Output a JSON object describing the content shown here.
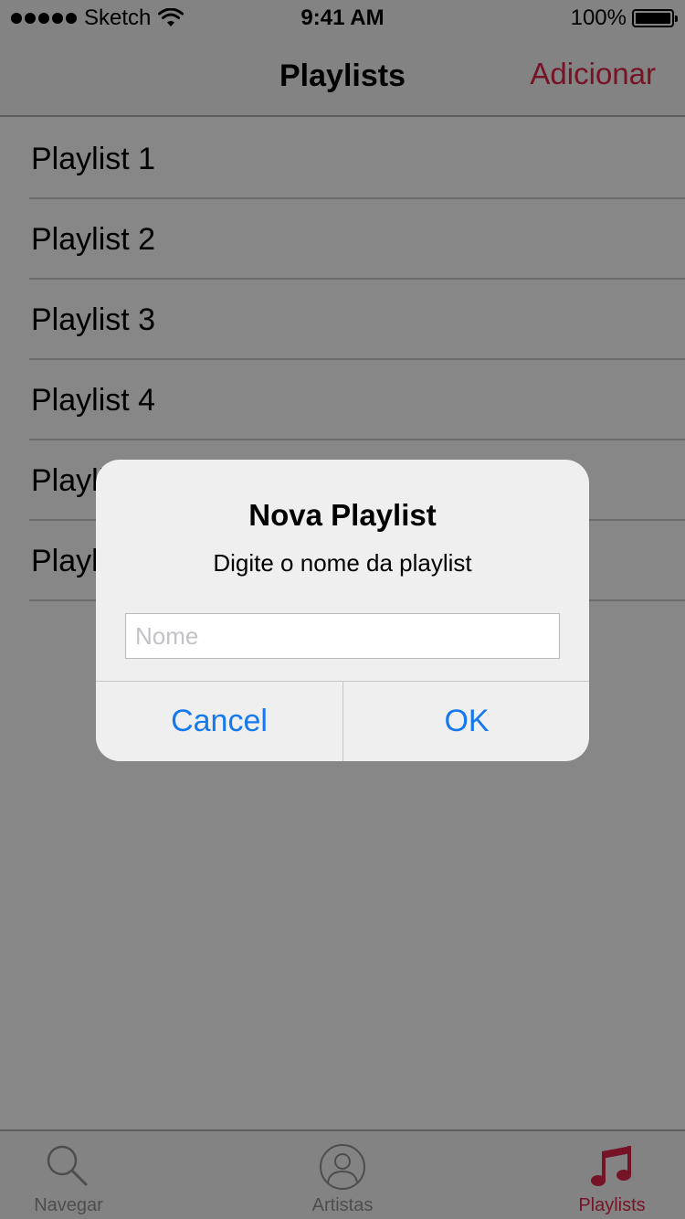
{
  "status_bar": {
    "carrier": "Sketch",
    "time": "9:41 AM",
    "battery": "100%"
  },
  "nav": {
    "title": "Playlists",
    "add_label": "Adicionar",
    "accent_color": "#e0254a"
  },
  "playlists": [
    {
      "label": "Playlist 1"
    },
    {
      "label": "Playlist 2"
    },
    {
      "label": "Playlist 3"
    },
    {
      "label": "Playlist 4"
    },
    {
      "label": "Playlist 5"
    },
    {
      "label": "Playlist 6"
    }
  ],
  "alert": {
    "title": "Nova Playlist",
    "message": "Digite o nome da playlist",
    "input_placeholder": "Nome",
    "input_value": "",
    "cancel_label": "Cancel",
    "ok_label": "OK",
    "button_color": "#1478ee"
  },
  "tab_bar": {
    "tabs": [
      {
        "label": "Navegar",
        "icon": "search-icon",
        "active": false
      },
      {
        "label": "Artistas",
        "icon": "person-circle-icon",
        "active": false
      },
      {
        "label": "Playlists",
        "icon": "music-note-icon",
        "active": true
      }
    ]
  }
}
